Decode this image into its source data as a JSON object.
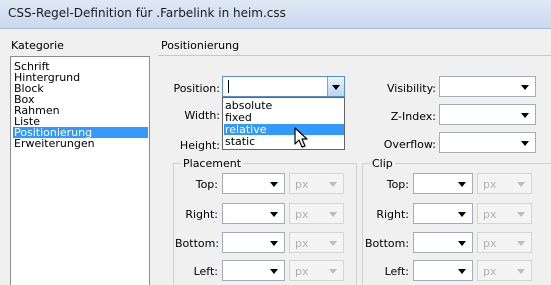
{
  "window": {
    "title": "CSS-Regel-Definition für .Farbelink in heim.css"
  },
  "category": {
    "heading": "Kategorie",
    "items": [
      "Schrift",
      "Hintergrund",
      "Block",
      "Box",
      "Rahmen",
      "Liste",
      "Positionierung",
      "Erweiterungen"
    ],
    "selected": "Positionierung"
  },
  "panel": {
    "heading": "Positionierung"
  },
  "fields": {
    "position": {
      "label": "Position:",
      "value": ""
    },
    "width": {
      "label": "Width:"
    },
    "height": {
      "label": "Height:"
    },
    "visibility": {
      "label": "Visibility:",
      "value": ""
    },
    "zindex": {
      "label": "Z-Index:",
      "value": ""
    },
    "overflow": {
      "label": "Overflow:",
      "value": ""
    }
  },
  "position_options": [
    "absolute",
    "fixed",
    "relative",
    "static"
  ],
  "position_highlighted": "relative",
  "placement": {
    "legend": "Placement",
    "rows": [
      {
        "label": "Top:",
        "value": "",
        "unit": "px"
      },
      {
        "label": "Right:",
        "value": "",
        "unit": "px"
      },
      {
        "label": "Bottom:",
        "value": "",
        "unit": "px"
      },
      {
        "label": "Left:",
        "value": "",
        "unit": "px"
      }
    ]
  },
  "clip": {
    "legend": "Clip",
    "rows": [
      {
        "label": "Top:",
        "value": "",
        "unit": "px"
      },
      {
        "label": "Right:",
        "value": "",
        "unit": "px"
      },
      {
        "label": "Bottom:",
        "value": "",
        "unit": "px"
      },
      {
        "label": "Left:",
        "value": "",
        "unit": "px"
      }
    ]
  },
  "colors": {
    "selection": "#3399ff",
    "title_bar": "#c9d9ee"
  }
}
